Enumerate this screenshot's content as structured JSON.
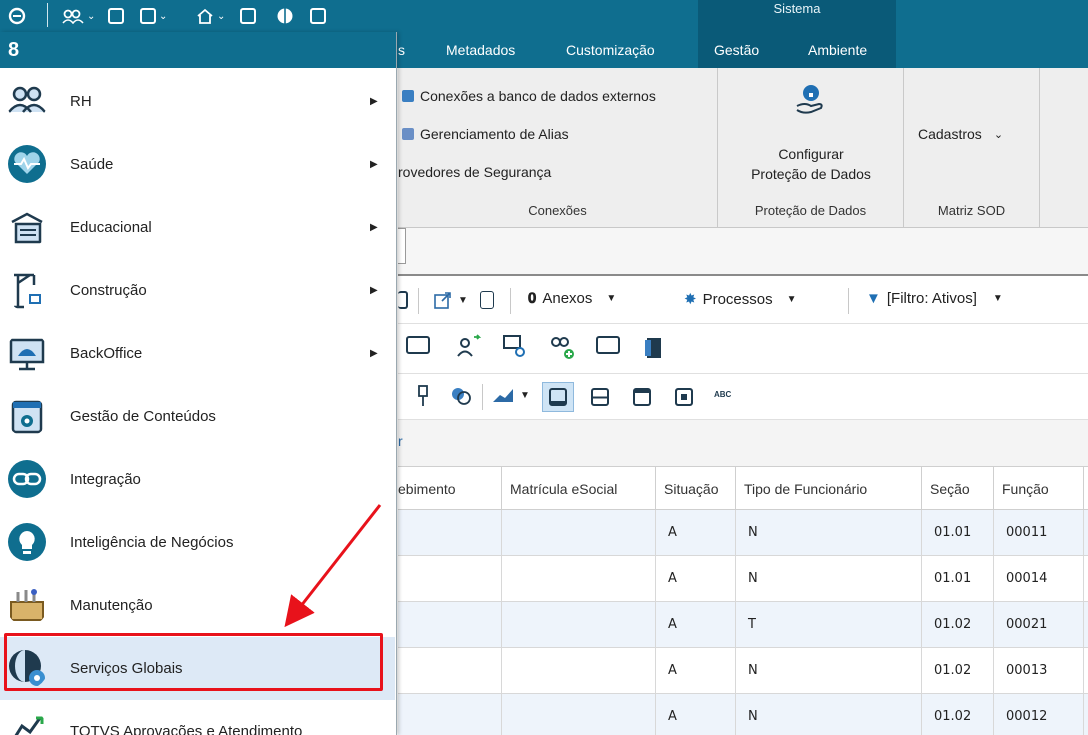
{
  "title_bar": {
    "group_label": "Sistema"
  },
  "ribbon_tabs": {
    "partial": "s",
    "metadados": "Metadados",
    "customizacao": "Customização",
    "gestao": "Gestão",
    "ambiente": "Ambiente"
  },
  "ribbon": {
    "conexoes": {
      "items": [
        "Conexões a banco de dados externos",
        "Gerenciamento de Alias",
        "rovedores de Segurança"
      ],
      "group_label": "Conexões"
    },
    "protecao": {
      "button_line1": "Configurar",
      "button_line2": "Proteção de Dados",
      "group_label": "Proteção de Dados"
    },
    "matriz": {
      "dropdown_label": "Cadastros",
      "group_label": "Matriz SOD"
    }
  },
  "toolbar": {
    "anexos": "Anexos",
    "processos": "Processos",
    "filtro": "[Filtro: Ativos]",
    "abc": "ABC",
    "partial_row": "r"
  },
  "grid": {
    "columns": [
      "ebimento",
      "Matrícula eSocial",
      "Situação",
      "Tipo de Funcionário",
      "Seção",
      "Função"
    ],
    "rows": [
      [
        "",
        "",
        "A",
        "N",
        "01.01",
        "00011"
      ],
      [
        "",
        "",
        "A",
        "N",
        "01.01",
        "00014"
      ],
      [
        "",
        "",
        "A",
        "T",
        "01.02",
        "00021"
      ],
      [
        "",
        "",
        "A",
        "N",
        "01.02",
        "00013"
      ],
      [
        "",
        "",
        "A",
        "N",
        "01.02",
        "00012"
      ]
    ]
  },
  "menu": {
    "items": [
      {
        "label": "RH",
        "icon": "people-icon",
        "has_submenu": true
      },
      {
        "label": "Saúde",
        "icon": "heart-pulse-icon",
        "has_submenu": true
      },
      {
        "label": "Educacional",
        "icon": "school-icon",
        "has_submenu": true
      },
      {
        "label": "Construção",
        "icon": "crane-icon",
        "has_submenu": true
      },
      {
        "label": "BackOffice",
        "icon": "monitor-icon",
        "has_submenu": true
      },
      {
        "label": "Gestão de Conteúdos",
        "icon": "content-gear-icon",
        "has_submenu": false
      },
      {
        "label": "Integração",
        "icon": "link-icon",
        "has_submenu": false
      },
      {
        "label": "Inteligência de Negócios",
        "icon": "brain-icon",
        "has_submenu": false
      },
      {
        "label": "Manutenção",
        "icon": "toolbox-icon",
        "has_submenu": false
      },
      {
        "label": "Serviços Globais",
        "icon": "globe-gear-icon",
        "has_submenu": false
      },
      {
        "label": "TOTVS Aprovações e Atendimento",
        "icon": "approval-icon",
        "has_submenu": false
      }
    ],
    "selected": "Serviços Globais"
  },
  "colors": {
    "brand": "#0f6e8f",
    "brand_dark": "#0a5a78",
    "highlight": "#e8121b",
    "row_alt": "#eef4fb"
  }
}
